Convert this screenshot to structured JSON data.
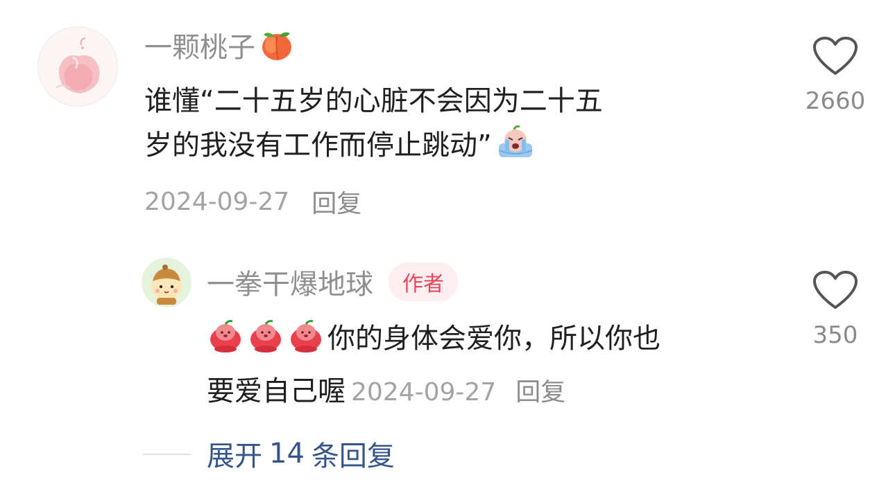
{
  "main_comment": {
    "username": "一颗桃子",
    "username_emoji": "peach-emoji",
    "text_line1": "谁懂“二十五岁的心脏不会因为二十五",
    "text_line2": "岁的我没有工作而停止跳动”",
    "trailing_emoji": "crying-emoji",
    "date": "2024-09-27",
    "reply_label": "回复",
    "like_count": "2660"
  },
  "reply_comment": {
    "username": "一拳干爆地球",
    "badge": "作者",
    "leading_emojis": [
      "apple-face-emoji",
      "apple-face-emoji",
      "apple-face-emoji"
    ],
    "text_line1": "你的身体会爱你，所以你也",
    "text_line2": "要爱自己喔",
    "date": "2024-09-27",
    "reply_label": "回复",
    "like_count": "350"
  },
  "expand": {
    "prefix": "展开",
    "count": "14",
    "suffix": "条回复"
  },
  "colors": {
    "username": "#8f8f8f",
    "body_text": "#1f1f1f",
    "meta_text": "#a3a3a3",
    "badge_bg": "#fdeef0",
    "badge_text": "#e4465b",
    "expand_text": "#34548a"
  }
}
